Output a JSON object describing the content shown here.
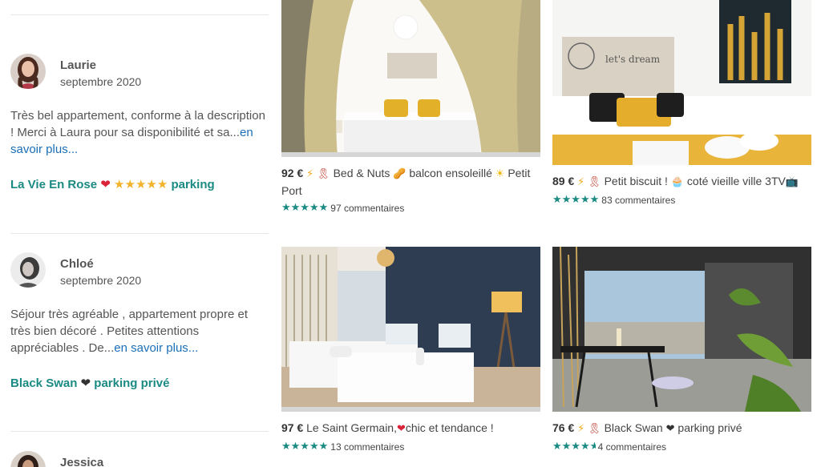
{
  "reviews": [
    {
      "name": "Laurie",
      "date": "septembre 2020",
      "text": "Très bel appartement, conforme à la description ! Merci à Laura pour sa disponibilité et sa...",
      "more": "en savoir plus...",
      "listing_name": "La Vie En Rose",
      "listing_suffix": "parking"
    },
    {
      "name": "Chloé",
      "date": "septembre 2020",
      "text": "Séjour très agréable , appartement propre et très bien décoré . Petites attentions appréciables . De...",
      "more": "en savoir plus...",
      "listing_name": "Black Swan",
      "listing_suffix": "parking privé"
    },
    {
      "name": "Jessica"
    }
  ],
  "listings": [
    {
      "price": "92 €",
      "title": "Bed & Nuts",
      "title_rest": "balcon ensoleillé",
      "title_end": "Petit Port",
      "rating": 5,
      "reviews": "97 commentaires"
    },
    {
      "price": "89 €",
      "title": "Petit biscuit !",
      "title_rest": "coté vieille ville 3TV",
      "rating": 5,
      "reviews": "83 commentaires"
    },
    {
      "price": "97 €",
      "title": "Le Saint Germain,",
      "title_rest": "chic et tendance !",
      "rating": 5,
      "reviews": "13 commentaires"
    },
    {
      "price": "76 €",
      "title": "Black Swan",
      "title_rest": "parking privé",
      "rating": 4.5,
      "reviews": "4 commentaires"
    }
  ],
  "images": {
    "listing1": "bedroom with beige curtains and yellow pillows",
    "listing2": "bedroom with dreamcatcher headboard and cactus art",
    "listing3": "twin beds with dark blue wall and floor lamp",
    "listing4": "balcony terrace with table and plants"
  },
  "colors": {
    "teal": "#1a8a83",
    "link": "#1a6fb8",
    "divider": "#e6e6e6"
  }
}
